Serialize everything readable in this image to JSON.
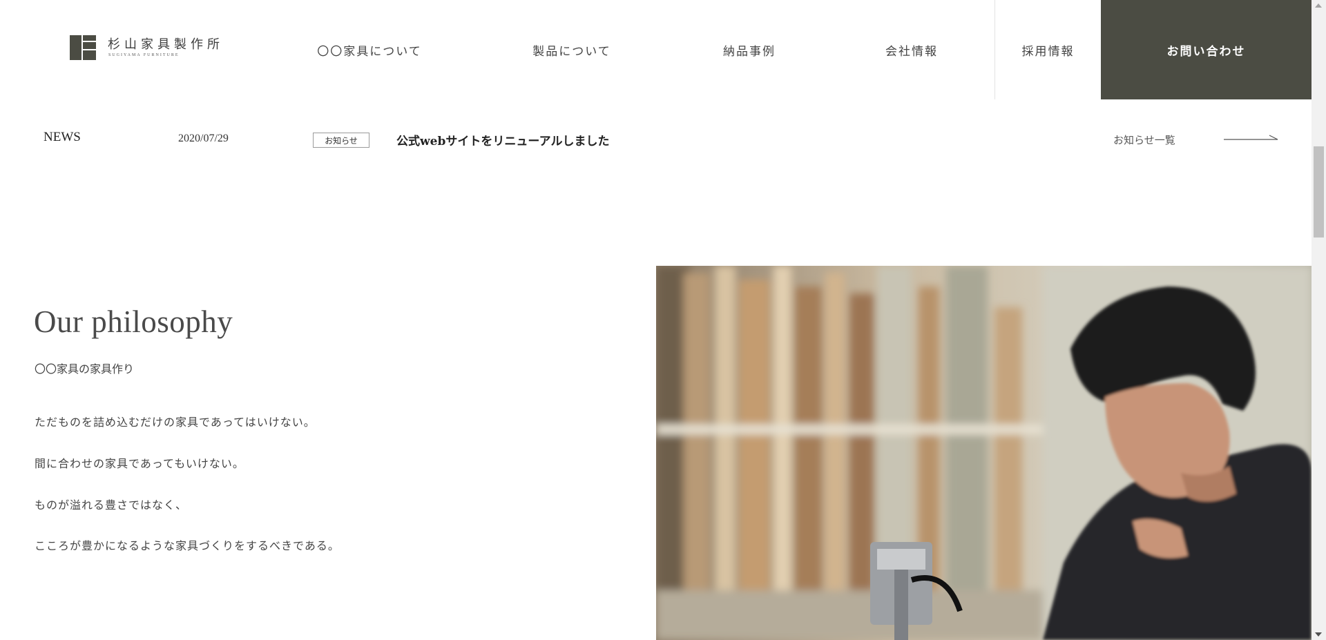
{
  "header": {
    "logo": {
      "name": "杉山家具製作所",
      "sub": "SUGIYAMA FURNITURE"
    },
    "nav": [
      {
        "label": "〇〇家具について"
      },
      {
        "label": "製品について"
      },
      {
        "label": "納品事例"
      },
      {
        "label": "会社情報"
      },
      {
        "label": "採用情報"
      },
      {
        "label": "お問い合わせ"
      }
    ]
  },
  "news": {
    "label": "NEWS",
    "date": "2020/07/29",
    "tag": "お知らせ",
    "title": "公式webサイトをリニューアルしました",
    "more": "お知らせ一覧"
  },
  "philosophy": {
    "heading": "Our philosophy",
    "sub": "〇〇家具の家具作り",
    "lines": [
      "ただものを詰め込むだけの家具であってはいけない。",
      "間に合わせの家具であってもいけない。",
      "ものが溢れる豊さではなく、",
      "こころが豊かになるような家具づくりをするべきである。"
    ]
  },
  "colors": {
    "accent": "#4b4c43",
    "text": "#3c3c3c"
  }
}
